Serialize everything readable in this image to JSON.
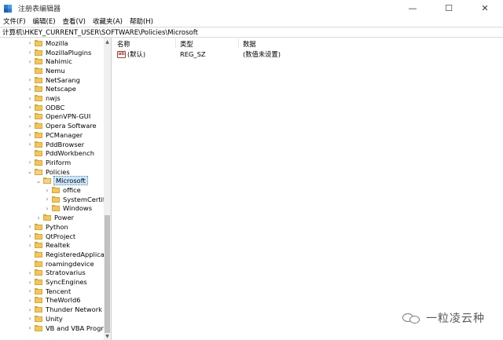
{
  "window": {
    "title": "注册表编辑器",
    "minimize_glyph": "—",
    "maximize_glyph": "☐",
    "close_glyph": "✕"
  },
  "menu": [
    "文件(F)",
    "编辑(E)",
    "查看(V)",
    "收藏夹(A)",
    "帮助(H)"
  ],
  "address": "计算机\\HKEY_CURRENT_USER\\SOFTWARE\\Policies\\Microsoft",
  "tree": [
    {
      "label": "Mozilla",
      "level": 0,
      "expander": "collapsed"
    },
    {
      "label": "MozillaPlugins",
      "level": 0,
      "expander": "collapsed"
    },
    {
      "label": "Nahimic",
      "level": 0,
      "expander": "collapsed"
    },
    {
      "label": "Nemu",
      "level": 0,
      "expander": "none"
    },
    {
      "label": "NetSarang",
      "level": 0,
      "expander": "collapsed"
    },
    {
      "label": "Netscape",
      "level": 0,
      "expander": "collapsed"
    },
    {
      "label": "nwjs",
      "level": 0,
      "expander": "collapsed"
    },
    {
      "label": "ODBC",
      "level": 0,
      "expander": "collapsed"
    },
    {
      "label": "OpenVPN-GUI",
      "level": 0,
      "expander": "collapsed"
    },
    {
      "label": "Opera Software",
      "level": 0,
      "expander": "collapsed"
    },
    {
      "label": "PCManager",
      "level": 0,
      "expander": "collapsed"
    },
    {
      "label": "PddBrowser",
      "level": 0,
      "expander": "collapsed"
    },
    {
      "label": "PddWorkbench",
      "level": 0,
      "expander": "none"
    },
    {
      "label": "Piriform",
      "level": 0,
      "expander": "collapsed"
    },
    {
      "label": "Policies",
      "level": 0,
      "expander": "expanded"
    },
    {
      "label": "Microsoft",
      "level": 1,
      "expander": "expanded",
      "selected": true
    },
    {
      "label": "office",
      "level": 2,
      "expander": "collapsed"
    },
    {
      "label": "SystemCertifi",
      "level": 2,
      "expander": "collapsed"
    },
    {
      "label": "Windows",
      "level": 2,
      "expander": "collapsed"
    },
    {
      "label": "Power",
      "level": 1,
      "expander": "collapsed"
    },
    {
      "label": "Python",
      "level": 0,
      "expander": "collapsed"
    },
    {
      "label": "QtProject",
      "level": 0,
      "expander": "collapsed"
    },
    {
      "label": "Realtek",
      "level": 0,
      "expander": "collapsed"
    },
    {
      "label": "RegisteredApplica",
      "level": 0,
      "expander": "none"
    },
    {
      "label": "roamingdevice",
      "level": 0,
      "expander": "none"
    },
    {
      "label": "Stratovarius",
      "level": 0,
      "expander": "collapsed"
    },
    {
      "label": "SyncEngines",
      "level": 0,
      "expander": "collapsed"
    },
    {
      "label": "Tencent",
      "level": 0,
      "expander": "collapsed"
    },
    {
      "label": "TheWorld6",
      "level": 0,
      "expander": "collapsed"
    },
    {
      "label": "Thunder Network",
      "level": 0,
      "expander": "collapsed"
    },
    {
      "label": "Unity",
      "level": 0,
      "expander": "collapsed"
    },
    {
      "label": "VB and VBA Progra",
      "level": 0,
      "expander": "collapsed"
    }
  ],
  "columns": {
    "name": "名称",
    "type": "类型",
    "data": "数据"
  },
  "values": [
    {
      "name": "(默认)",
      "type": "REG_SZ",
      "data": "(数值未设置)",
      "icon": "ab-string-icon",
      "icon_text": "ab"
    }
  ],
  "scrollbar": {
    "up_glyph": "▲",
    "down_glyph": "▼"
  },
  "watermark": "一粒凌云种"
}
